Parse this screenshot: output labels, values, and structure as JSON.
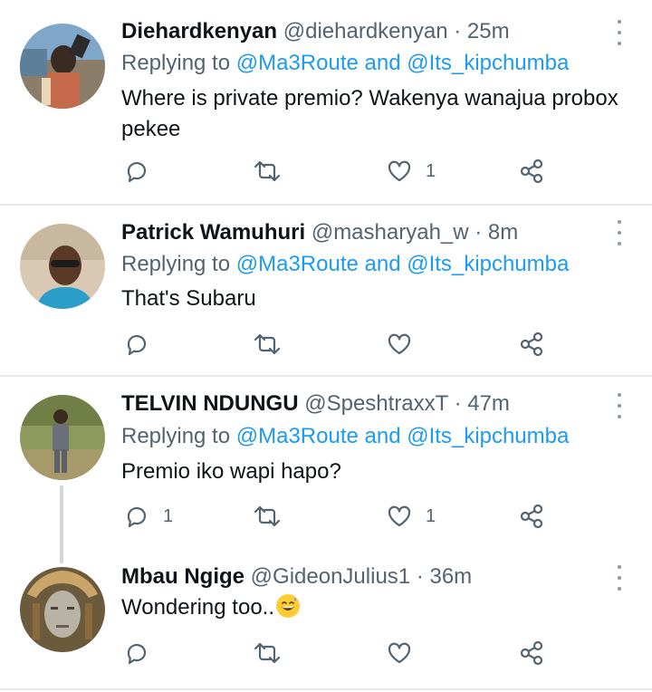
{
  "tweets": [
    {
      "name": "Diehardkenyan",
      "handle": "@diehardkenyan",
      "time": "· 25m",
      "replying_prefix": "Replying to ",
      "replying_to": "@Ma3Route and @Its_kipchumba",
      "text": "Where is private premio? Wakenya wanajua probox pekee",
      "reply_count": "",
      "like_count": "1"
    },
    {
      "name": "Patrick Wamuhuri",
      "handle": "@masharyah_w",
      "time": "· 8m",
      "replying_prefix": "Replying to ",
      "replying_to": "@Ma3Route and @Its_kipchumba",
      "text": "That's Subaru",
      "reply_count": "",
      "like_count": ""
    },
    {
      "name": "TELVIN NDUNGU",
      "handle": "@SpeshtraxxT",
      "time": "· 47m",
      "replying_prefix": "Replying to ",
      "replying_to": "@Ma3Route and @Its_kipchumba",
      "text": "Premio iko wapi hapo?",
      "reply_count": "1",
      "like_count": "1"
    },
    {
      "name": "Mbau Ngige",
      "handle": "@GideonJulius1",
      "time": "· 36m",
      "text": "Wondering too..",
      "emoji": "grinning-face-with-sweat",
      "reply_count": "",
      "like_count": ""
    }
  ],
  "icons": {
    "reply": "reply-icon",
    "retweet": "retweet-icon",
    "like": "heart-icon",
    "share": "share-icon",
    "more": "more-options-icon"
  },
  "colors": {
    "link": "#1d9bf0",
    "secondary_text": "#536471",
    "icon": "#536471",
    "divider": "#e6e9ec"
  }
}
